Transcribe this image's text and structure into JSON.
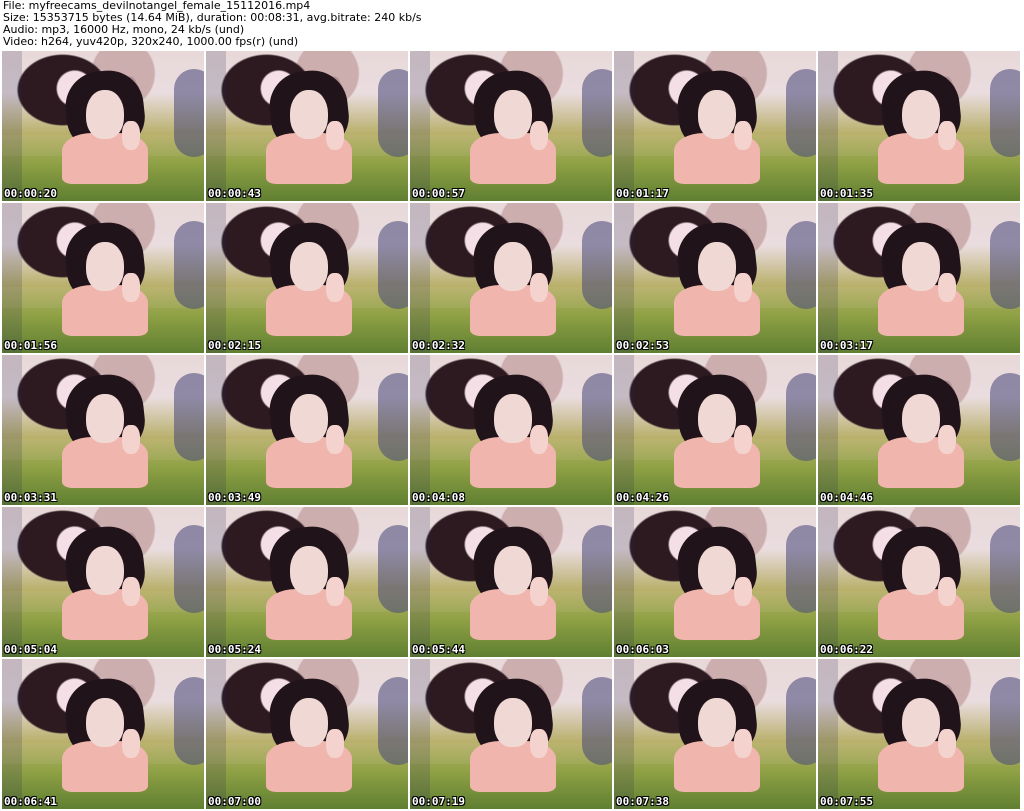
{
  "header": {
    "file": "File: myfreecams_devilnotangel_female_15112016.mp4",
    "size": "Size: 15353715 bytes (14.64 MiB), duration: 00:08:31, avg.bitrate: 240 kb/s",
    "audio": "Audio: mp3, 16000 Hz, mono, 24 kb/s (und)",
    "video": "Video: h264, yuv420p, 320x240, 1000.00 fps(r) (und)"
  },
  "thumbnails": [
    {
      "timestamp": "00:00:20"
    },
    {
      "timestamp": "00:00:43"
    },
    {
      "timestamp": "00:00:57"
    },
    {
      "timestamp": "00:01:17"
    },
    {
      "timestamp": "00:01:35"
    },
    {
      "timestamp": "00:01:56"
    },
    {
      "timestamp": "00:02:15"
    },
    {
      "timestamp": "00:02:32"
    },
    {
      "timestamp": "00:02:53"
    },
    {
      "timestamp": "00:03:17"
    },
    {
      "timestamp": "00:03:31"
    },
    {
      "timestamp": "00:03:49"
    },
    {
      "timestamp": "00:04:08"
    },
    {
      "timestamp": "00:04:26"
    },
    {
      "timestamp": "00:04:46"
    },
    {
      "timestamp": "00:05:04"
    },
    {
      "timestamp": "00:05:24"
    },
    {
      "timestamp": "00:05:44"
    },
    {
      "timestamp": "00:06:03"
    },
    {
      "timestamp": "00:06:22"
    },
    {
      "timestamp": "00:06:41"
    },
    {
      "timestamp": "00:07:00"
    },
    {
      "timestamp": "00:07:19"
    },
    {
      "timestamp": "00:07:38"
    },
    {
      "timestamp": "00:07:55"
    }
  ]
}
